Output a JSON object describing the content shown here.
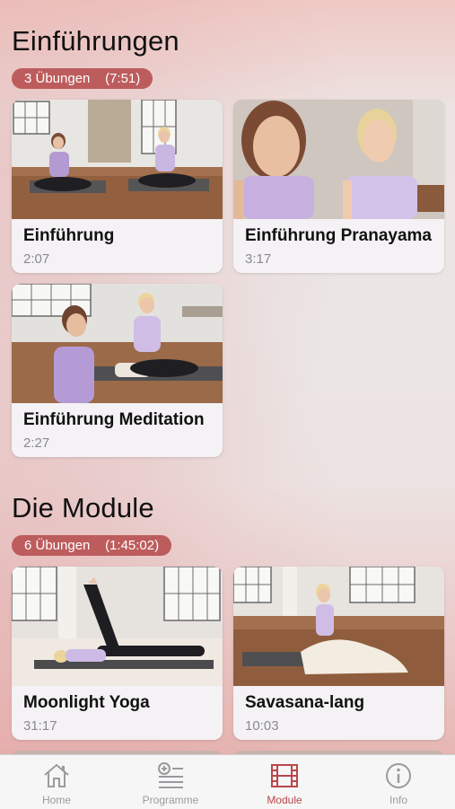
{
  "sections": [
    {
      "title": "Einführungen",
      "badge": "3 Übungen    (7:51)",
      "cards": [
        {
          "title": "Einführung",
          "duration": "2:07"
        },
        {
          "title": "Einführung Pranayama",
          "duration": "3:17"
        },
        {
          "title": "Einführung Meditation",
          "duration": "2:27"
        }
      ]
    },
    {
      "title": "Die Module",
      "badge": "6 Übungen    (1:45:02)",
      "cards": [
        {
          "title": "Moonlight Yoga",
          "duration": "31:17"
        },
        {
          "title": "Savasana-lang",
          "duration": "10:03"
        }
      ]
    }
  ],
  "tabbar": {
    "tabs": [
      {
        "label": "Home",
        "icon": "house-icon"
      },
      {
        "label": "Programme",
        "icon": "programs-list-icon"
      },
      {
        "label": "Module",
        "icon": "film-icon",
        "active": true
      },
      {
        "label": "Info",
        "icon": "info-icon"
      }
    ]
  },
  "colors": {
    "accent": "#bd5c5d",
    "active_tab": "#b9474a",
    "inactive_tab": "#9a9a9e"
  }
}
